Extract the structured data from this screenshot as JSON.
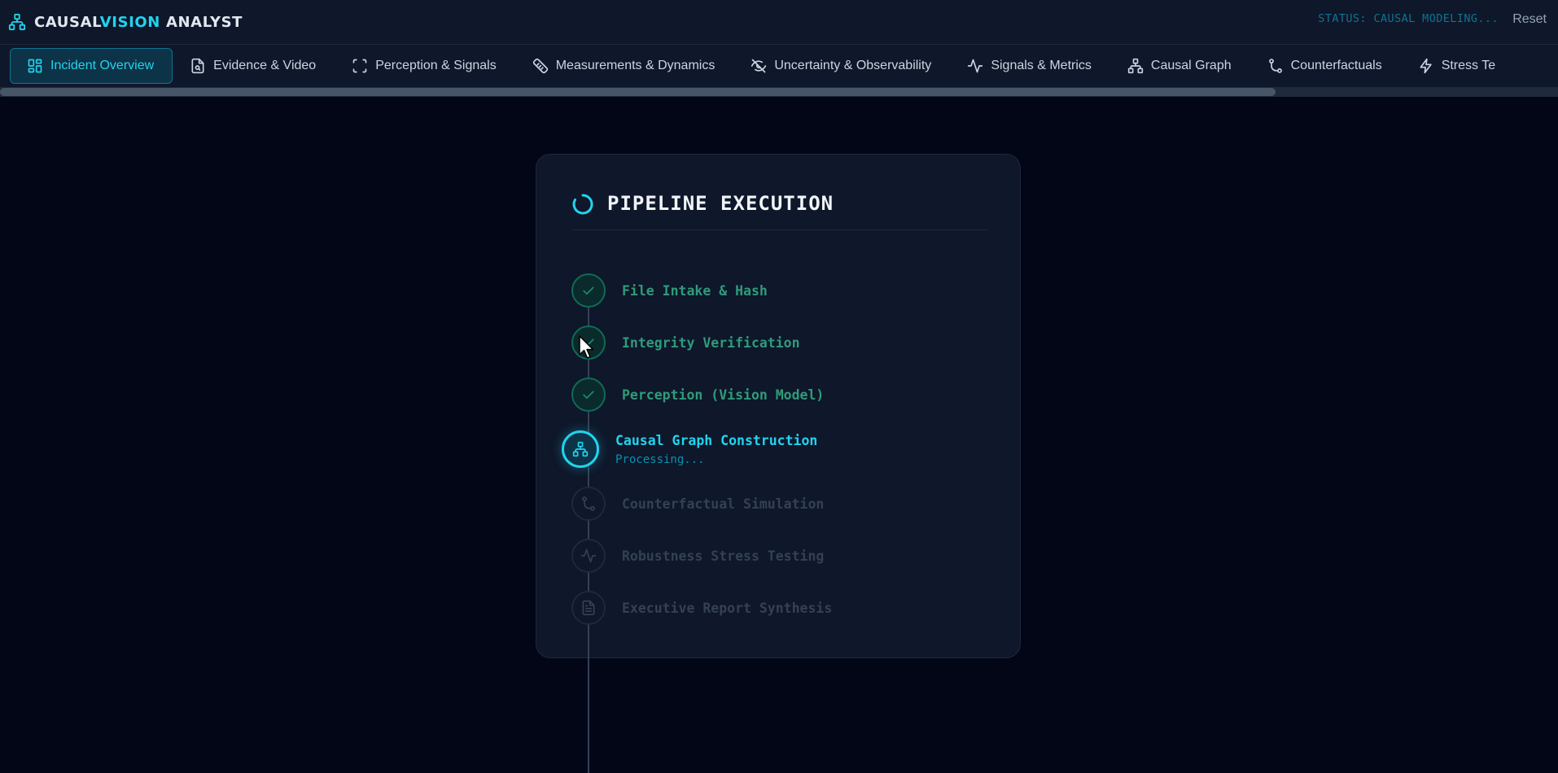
{
  "header": {
    "brand_part1": "CAUSAL",
    "brand_part2": "VISION",
    "brand_part3": "ANALYST",
    "status": "STATUS: CAUSAL MODELING...",
    "reset_label": "Reset"
  },
  "tabs": [
    {
      "label": "Incident Overview",
      "icon": "grid-icon",
      "active": true
    },
    {
      "label": "Evidence & Video",
      "icon": "file-search-icon"
    },
    {
      "label": "Perception & Signals",
      "icon": "scan-frame-icon"
    },
    {
      "label": "Measurements & Dynamics",
      "icon": "ruler-icon"
    },
    {
      "label": "Uncertainty & Observability",
      "icon": "eye-off-icon"
    },
    {
      "label": "Signals & Metrics",
      "icon": "activity-icon"
    },
    {
      "label": "Causal Graph",
      "icon": "network-icon"
    },
    {
      "label": "Counterfactuals",
      "icon": "branch-icon"
    },
    {
      "label": "Stress Te",
      "icon": "bolt-icon"
    }
  ],
  "pipeline": {
    "title": "PIPELINE EXECUTION",
    "steps": [
      {
        "label": "File Intake & Hash",
        "state": "done",
        "icon": "check-icon"
      },
      {
        "label": "Integrity Verification",
        "state": "done",
        "icon": "check-icon"
      },
      {
        "label": "Perception (Vision Model)",
        "state": "done",
        "icon": "check-icon"
      },
      {
        "label": "Causal Graph Construction",
        "state": "active",
        "icon": "network-icon",
        "sub": "Processing..."
      },
      {
        "label": "Counterfactual Simulation",
        "state": "pending",
        "icon": "branch-icon"
      },
      {
        "label": "Robustness Stress Testing",
        "state": "pending",
        "icon": "activity-icon"
      },
      {
        "label": "Executive Report Synthesis",
        "state": "pending",
        "icon": "document-icon"
      }
    ]
  },
  "colors": {
    "accent": "#22d3ee",
    "done": "#2f9b7a",
    "pending": "#334155",
    "background": "#020617",
    "panel": "#0f172a"
  }
}
